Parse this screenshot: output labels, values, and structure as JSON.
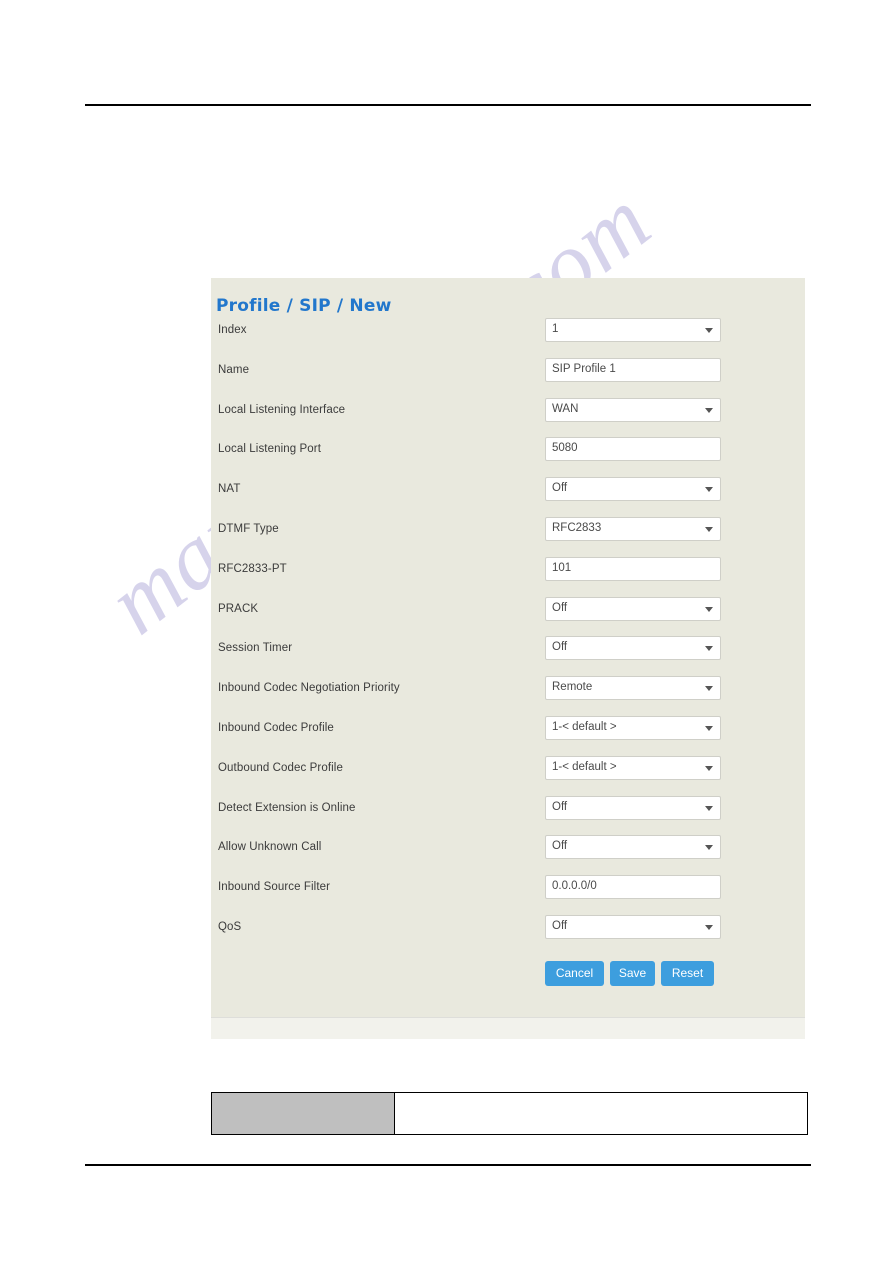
{
  "panel": {
    "title": "Profile / SIP / New",
    "fields": [
      {
        "label": "Index",
        "value": "1",
        "type": "select"
      },
      {
        "label": "Name",
        "value": "SIP Profile 1",
        "type": "text"
      },
      {
        "label": "Local Listening Interface",
        "value": "WAN",
        "type": "select"
      },
      {
        "label": "Local Listening Port",
        "value": "5080",
        "type": "text"
      },
      {
        "label": "NAT",
        "value": "Off",
        "type": "select"
      },
      {
        "label": "DTMF Type",
        "value": "RFC2833",
        "type": "select"
      },
      {
        "label": "RFC2833-PT",
        "value": "101",
        "type": "text"
      },
      {
        "label": "PRACK",
        "value": "Off",
        "type": "select"
      },
      {
        "label": "Session Timer",
        "value": "Off",
        "type": "select"
      },
      {
        "label": "Inbound Codec Negotiation Priority",
        "value": "Remote",
        "type": "select"
      },
      {
        "label": "Inbound Codec Profile",
        "value": "1-< default >",
        "type": "select"
      },
      {
        "label": "Outbound Codec Profile",
        "value": "1-< default >",
        "type": "select"
      },
      {
        "label": "Detect Extension is Online",
        "value": "Off",
        "type": "select"
      },
      {
        "label": "Allow Unknown Call",
        "value": "Off",
        "type": "select"
      },
      {
        "label": "Inbound Source Filter",
        "value": "0.0.0.0/0",
        "type": "text"
      },
      {
        "label": "QoS",
        "value": "Off",
        "type": "select"
      }
    ],
    "buttons": {
      "cancel": "Cancel",
      "save": "Save",
      "reset": "Reset"
    }
  },
  "bottom_table": {
    "rows": [
      {
        "shaded_cell": "",
        "plain_cell": ""
      }
    ]
  },
  "watermark": {
    "text": "manualshive.com"
  },
  "colors": {
    "accent_blue": "#2277cc",
    "button_blue": "#3d9ede",
    "panel_background": "#e9e9de",
    "shaded_cell": "#bfbfbf"
  }
}
